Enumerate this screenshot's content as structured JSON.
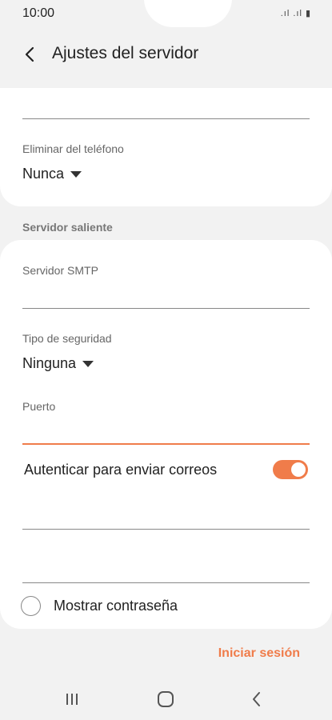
{
  "status": {
    "time": "10:00",
    "signal": ".ıl .ıl ▮"
  },
  "appbar": {
    "title": "Ajustes del servidor",
    "back_icon": "back-arrow-icon"
  },
  "incoming": {
    "delete_label": "Eliminar del teléfono",
    "delete_value": "Nunca"
  },
  "outgoing": {
    "section_title": "Servidor saliente",
    "smtp_label": "Servidor SMTP",
    "smtp_value": "",
    "security_label": "Tipo de seguridad",
    "security_value": "Ninguna",
    "port_label": "Puerto",
    "port_value": "",
    "auth_label": "Autenticar para enviar correos",
    "auth_on": true,
    "username_value": "",
    "password_value": "",
    "show_password_label": "Mostrar contraseña"
  },
  "actions": {
    "sign_in": "Iniciar sesión"
  },
  "colors": {
    "accent": "#f07c4a",
    "background": "#f2f2f2",
    "card": "#ffffff"
  },
  "navbar": {
    "recent_icon": "recent-apps-icon",
    "home_icon": "home-icon",
    "back_icon": "nav-back-icon"
  }
}
